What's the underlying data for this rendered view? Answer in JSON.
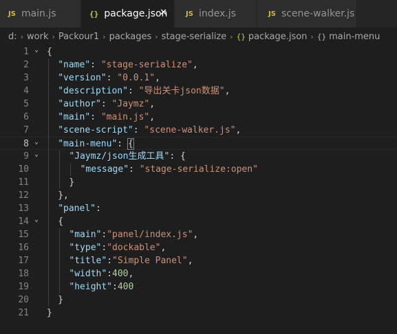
{
  "tabs": [
    {
      "icon": "JS",
      "label": "main.js",
      "active": false
    },
    {
      "icon": "{}",
      "label": "package.json",
      "active": true,
      "close": "✕"
    },
    {
      "icon": "JS",
      "label": "index.js",
      "active": false
    },
    {
      "icon": "JS",
      "label": "scene-walker.js",
      "active": false
    }
  ],
  "breadcrumb": {
    "items": [
      "d:",
      "work",
      "Packour1",
      "packages",
      "stage-serialize",
      "package.json",
      "main-menu"
    ],
    "file_icon": "{}",
    "sep": "›"
  },
  "editor": {
    "current_line": 8,
    "lines": [
      {
        "n": "1",
        "text": "{"
      },
      {
        "n": "2",
        "key": "\"name\"",
        "colon": ": ",
        "val": "\"stage-serialize\"",
        "tail": ","
      },
      {
        "n": "3",
        "key": "\"version\"",
        "colon": ": ",
        "val": "\"0.0.1\"",
        "tail": ","
      },
      {
        "n": "4",
        "key": "\"description\"",
        "colon": ": ",
        "val": "\"导出关卡json数据\"",
        "tail": ","
      },
      {
        "n": "5",
        "key": "\"author\"",
        "colon": ": ",
        "val": "\"Jaymz\"",
        "tail": ","
      },
      {
        "n": "6",
        "key": "\"main\"",
        "colon": ": ",
        "val": "\"main.js\"",
        "tail": ","
      },
      {
        "n": "7",
        "key": "\"scene-script\"",
        "colon": ": ",
        "val": "\"scene-walker.js\"",
        "tail": ","
      },
      {
        "n": "8",
        "key": "\"main-menu\"",
        "colon": ": ",
        "val": "{",
        "tail": ""
      },
      {
        "n": "9",
        "key": "\"Jaymz/json生成工具\"",
        "colon": ": ",
        "val": "{",
        "tail": ""
      },
      {
        "n": "10",
        "key": "\"message\"",
        "colon": ": ",
        "val": "\"stage-serialize:open\"",
        "tail": ""
      },
      {
        "n": "11",
        "text": "}"
      },
      {
        "n": "12",
        "text": "},"
      },
      {
        "n": "13",
        "key": "\"panel\"",
        "colon": ":",
        "val": "",
        "tail": ""
      },
      {
        "n": "14",
        "text": "{"
      },
      {
        "n": "15",
        "key": "\"main\"",
        "colon": ":",
        "val": "\"panel/index.js\"",
        "tail": ","
      },
      {
        "n": "16",
        "key": "\"type\"",
        "colon": ":",
        "val": "\"dockable\"",
        "tail": ","
      },
      {
        "n": "17",
        "key": "\"title\"",
        "colon": ":",
        "val": "\"Simple Panel\"",
        "tail": ","
      },
      {
        "n": "18",
        "key": "\"width\"",
        "colon": ":",
        "num": "400",
        "tail": ","
      },
      {
        "n": "19",
        "key": "\"height\"",
        "colon": ":",
        "num": "400",
        "tail": ""
      },
      {
        "n": "20",
        "text": "}"
      },
      {
        "n": "21",
        "text": "}"
      }
    ]
  },
  "colors": {
    "background": "#1e1e1e",
    "key": "#9cdcfe",
    "string": "#ce9178",
    "number": "#b5cea8",
    "punctuation": "#d4d4d4",
    "js_icon": "#d7ba38",
    "json_icon": "#cbcb41"
  },
  "icons": {
    "fold": "chevron-down-icon",
    "close": "close-icon"
  }
}
